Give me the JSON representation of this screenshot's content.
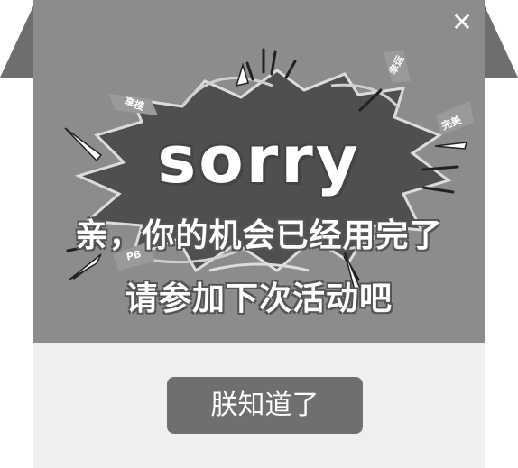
{
  "popup": {
    "close_symbol": "✕",
    "title_sorry": "sorry",
    "title_line1": "亲，你的机会已经用完了",
    "title_line2": "请参加下次活动吧",
    "tags": [
      "享搜",
      "幸运",
      "完美",
      "PB"
    ],
    "confirm_label": "朕知道了"
  },
  "colors": {
    "banner": "#8c8c8c",
    "burst": "#4f4f4f",
    "button": "#6f6f6f",
    "body": "#efefef",
    "roof": "#6e6e6e"
  }
}
